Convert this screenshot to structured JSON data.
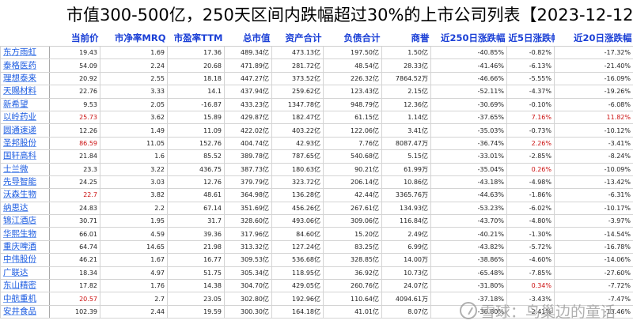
{
  "title": "市值300-500亿，250天区间内跌幅超过30%的上市公司列表【2023-12-12】",
  "headers": [
    "",
    "当前价",
    "市净率MRQ",
    "市盈率TTM",
    "总市值",
    "资产合计",
    "负债合计",
    "商誉",
    "近250日涨跌幅",
    "近5日涨跌幅",
    "近20日涨跌幅"
  ],
  "rows": [
    {
      "name": "东方雨虹",
      "price": "19.43",
      "pb": "1.69",
      "pe": "17.36",
      "mcap": "489.34亿",
      "assets": "473.13亿",
      "liab": "197.50亿",
      "goodwill": "1.50亿",
      "c250": "-40.85%",
      "c5": "-0.82%",
      "c20": "-17.32%"
    },
    {
      "name": "泰格医药",
      "price": "54.09",
      "pb": "2.24",
      "pe": "20.68",
      "mcap": "471.89亿",
      "assets": "281.72亿",
      "liab": "48.54亿",
      "goodwill": "28.33亿",
      "c250": "-41.46%",
      "c5": "-6.13%",
      "c20": "-21.40%"
    },
    {
      "name": "理想泰来",
      "price": "20.92",
      "pb": "2.55",
      "pe": "18.18",
      "mcap": "447.27亿",
      "assets": "373.52亿",
      "liab": "226.32亿",
      "goodwill": "7864.52万",
      "c250": "-46.66%",
      "c5": "-5.55%",
      "c20": "-16.09%"
    },
    {
      "name": "天赐材料",
      "price": "22.76",
      "pb": "3.33",
      "pe": "14.1",
      "mcap": "437.94亿",
      "assets": "259.62亿",
      "liab": "123.43亿",
      "goodwill": "2.15亿",
      "c250": "-52.11%",
      "c5": "-4.37%",
      "c20": "-19.26%"
    },
    {
      "name": "新希望",
      "price": "9.53",
      "pb": "2.05",
      "pe": "-16.87",
      "mcap": "433.23亿",
      "assets": "1347.78亿",
      "liab": "948.79亿",
      "goodwill": "12.36亿",
      "c250": "-30.69%",
      "c5": "-0.10%",
      "c20": "-6.08%"
    },
    {
      "name": "以岭药业",
      "price": "25.73",
      "pb": "3.62",
      "pe": "15.89",
      "mcap": "429.87亿",
      "assets": "182.47亿",
      "liab": "61.15亿",
      "goodwill": "1.14亿",
      "c250": "-37.65%",
      "c5": "7.16%",
      "c20": "11.82%",
      "priceUp": true,
      "c5Up": true,
      "c20Up": true
    },
    {
      "name": "圆通速递",
      "price": "12.26",
      "pb": "1.49",
      "pe": "11.09",
      "mcap": "422.02亿",
      "assets": "403.22亿",
      "liab": "122.06亿",
      "goodwill": "3.41亿",
      "c250": "-35.03%",
      "c5": "-0.73%",
      "c20": "-10.12%"
    },
    {
      "name": "圣邦股份",
      "price": "86.59",
      "pb": "11.05",
      "pe": "152.76",
      "mcap": "404.74亿",
      "assets": "42.93亿",
      "liab": "7.76亿",
      "goodwill": "8087.47万",
      "c250": "-36.74%",
      "c5": "2.26%",
      "c20": "-3.41%",
      "priceUp": true,
      "c5Up": true
    },
    {
      "name": "国轩高科",
      "price": "21.84",
      "pb": "1.6",
      "pe": "85.52",
      "mcap": "389.78亿",
      "assets": "787.65亿",
      "liab": "540.68亿",
      "goodwill": "5.15亿",
      "c250": "-33.01%",
      "c5": "-2.85%",
      "c20": "-8.24%"
    },
    {
      "name": "士兰微",
      "price": "23.3",
      "pb": "3.22",
      "pe": "436.75",
      "mcap": "387.73亿",
      "assets": "180.63亿",
      "liab": "90.21亿",
      "goodwill": "61.99万",
      "c250": "-35.04%",
      "c5": "0.26%",
      "c20": "-10.09%",
      "c5Up": true
    },
    {
      "name": "先导智能",
      "price": "24.25",
      "pb": "3.03",
      "pe": "12.76",
      "mcap": "379.79亿",
      "assets": "323.72亿",
      "liab": "206.14亿",
      "goodwill": "10.86亿",
      "c250": "-43.18%",
      "c5": "-4.98%",
      "c20": "-13.42%"
    },
    {
      "name": "沃森生物",
      "price": "22.7",
      "pb": "3.82",
      "pe": "48.61",
      "mcap": "364.98亿",
      "assets": "136.28亿",
      "liab": "42.44亿",
      "goodwill": "3365.76万",
      "c250": "-44.63%",
      "c5": "-1.86%",
      "c20": "-6.31%",
      "priceUp": true
    },
    {
      "name": "纳思达",
      "price": "24.83",
      "pb": "2.2",
      "pe": "67.14",
      "mcap": "351.69亿",
      "assets": "456.26亿",
      "liab": "267.61亿",
      "goodwill": "134.93亿",
      "c250": "-53.23%",
      "c5": "-6.02%",
      "c20": "-10.17%"
    },
    {
      "name": "锦江酒店",
      "price": "30.71",
      "pb": "1.95",
      "pe": "31.7",
      "mcap": "328.60亿",
      "assets": "493.06亿",
      "liab": "309.06亿",
      "goodwill": "116.84亿",
      "c250": "-43.70%",
      "c5": "-4.80%",
      "c20": "-3.97%"
    },
    {
      "name": "华熙生物",
      "price": "66.01",
      "pb": "4.59",
      "pe": "39.36",
      "mcap": "317.96亿",
      "assets": "84.60亿",
      "liab": "15.20亿",
      "goodwill": "2.49亿",
      "c250": "-40.21%",
      "c5": "-1.30%",
      "c20": "-14.54%"
    },
    {
      "name": "重庆啤酒",
      "price": "64.74",
      "pb": "14.65",
      "pe": "21.98",
      "mcap": "313.32亿",
      "assets": "127.24亿",
      "liab": "83.25亿",
      "goodwill": "6.99亿",
      "c250": "-43.82%",
      "c5": "-5.72%",
      "c20": "-16.78%"
    },
    {
      "name": "中伟股份",
      "price": "46.21",
      "pb": "1.67",
      "pe": "16.77",
      "mcap": "309.53亿",
      "assets": "536.68亿",
      "liab": "328.85亿",
      "goodwill": "14.00万",
      "c250": "-38.86%",
      "c5": "-4.60%",
      "c20": "-14.06%"
    },
    {
      "name": "广联达",
      "price": "18.34",
      "pb": "4.97",
      "pe": "51.75",
      "mcap": "305.34亿",
      "assets": "118.95亿",
      "liab": "36.92亿",
      "goodwill": "10.73亿",
      "c250": "-65.48%",
      "c5": "-7.85%",
      "c20": "-27.60%"
    },
    {
      "name": "东山精密",
      "price": "17.82",
      "pb": "1.76",
      "pe": "14.38",
      "mcap": "304.70亿",
      "assets": "429.05亿",
      "liab": "260.76亿",
      "goodwill": "24.07亿",
      "c250": "-31.80%",
      "c5": "0.34%",
      "c20": "-7.72%",
      "c5Up": true
    },
    {
      "name": "中航重机",
      "price": "20.57",
      "pb": "2.7",
      "pe": "23.05",
      "mcap": "302.80亿",
      "assets": "192.96亿",
      "liab": "110.64亿",
      "goodwill": "4094.61万",
      "c250": "-37.18%",
      "c5": "-3.43%",
      "c20": "-7.47%",
      "priceUp": true
    },
    {
      "name": "安井食品",
      "price": "102.39",
      "pb": "2.44",
      "pe": "19.59",
      "mcap": "300.30亿",
      "assets": "164.18亿",
      "liab": "41.01亿",
      "goodwill": "8.07亿",
      "c250": "-36.80%",
      "c5": "-2.41%",
      "c20": "-13.46%"
    }
  ],
  "watermark": "雪球：鸟巢边的童话"
}
